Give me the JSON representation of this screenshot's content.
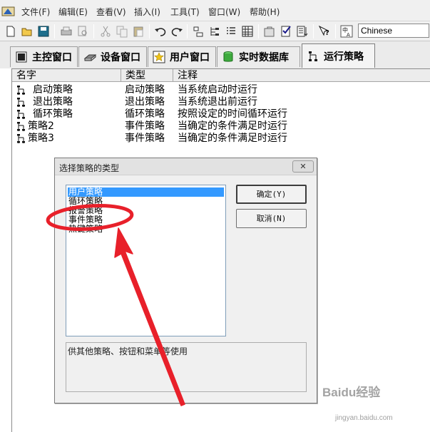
{
  "menu": [
    "文件(F)",
    "编辑(E)",
    "查看(V)",
    "插入(I)",
    "工具(T)",
    "窗口(W)",
    "帮助(H)"
  ],
  "toolbar": {
    "language_value": "Chinese"
  },
  "tabs": [
    {
      "label": "主控窗口",
      "icon": "monitor-icon",
      "active": false
    },
    {
      "label": "设备窗口",
      "icon": "device-icon",
      "active": false
    },
    {
      "label": "用户窗口",
      "icon": "star-window-icon",
      "active": false
    },
    {
      "label": "实时数据库",
      "icon": "database-icon",
      "active": false
    },
    {
      "label": "运行策略",
      "icon": "strategy-icon",
      "active": true
    }
  ],
  "strategy_list": {
    "columns": [
      "名字",
      "类型",
      "注释"
    ],
    "rows": [
      {
        "name": "启动策略",
        "type": "启动策略",
        "note": "当系统启动时运行"
      },
      {
        "name": "退出策略",
        "type": "退出策略",
        "note": "当系统退出前运行"
      },
      {
        "name": "循环策略",
        "type": "循环策略",
        "note": "按照设定的时间循环运行"
      },
      {
        "name": "策略2",
        "type": "事件策略",
        "note": "当确定的条件满足时运行"
      },
      {
        "name": "策略3",
        "type": "事件策略",
        "note": "当确定的条件满足时运行"
      }
    ]
  },
  "dialog": {
    "title": "选择策略的类型",
    "close_symbol": "✕",
    "options": [
      "用户策略",
      "循环策略",
      "报警策略",
      "事件策略",
      "热键策略"
    ],
    "selected_index": 0,
    "ok_label": "确定(Y)",
    "cancel_label": "取消(N)",
    "description": "供其他策略、按钮和菜单等使用"
  },
  "annotation": {
    "color": "#e8202a",
    "highlighted_option": "事件策略"
  },
  "watermark": {
    "text": "Baidu经验",
    "url": "jingyan.baidu.com"
  }
}
